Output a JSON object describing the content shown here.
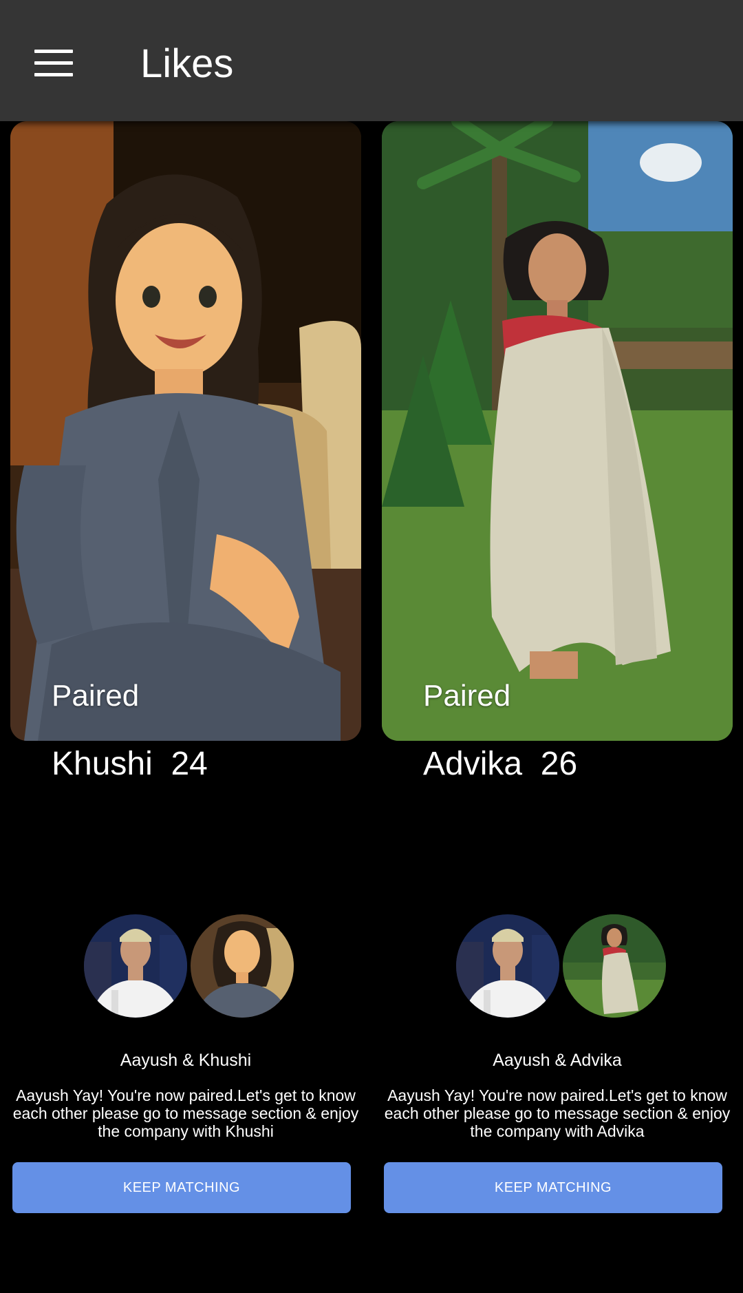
{
  "header": {
    "menu_icon": "hamburger-menu-icon",
    "title": "Likes"
  },
  "cards": [
    {
      "badge": "Paired",
      "name_age": "Khushi  24",
      "pair_names": "Aayush & Khushi",
      "message": "Aayush Yay! You're now paired.Let's get to know each other please go to message section & enjoy the company with Khushi",
      "button_label": "KEEP MATCHING"
    },
    {
      "badge": "Paired",
      "name_age": "Advika  26",
      "pair_names": "Aayush & Advika",
      "message": "Aayush Yay! You're now paired.Let's get to know each other please go to message section & enjoy the company with Advika",
      "button_label": "KEEP MATCHING"
    }
  ],
  "colors": {
    "topbar": "#353535",
    "background": "#000000",
    "button": "#6490e6"
  }
}
